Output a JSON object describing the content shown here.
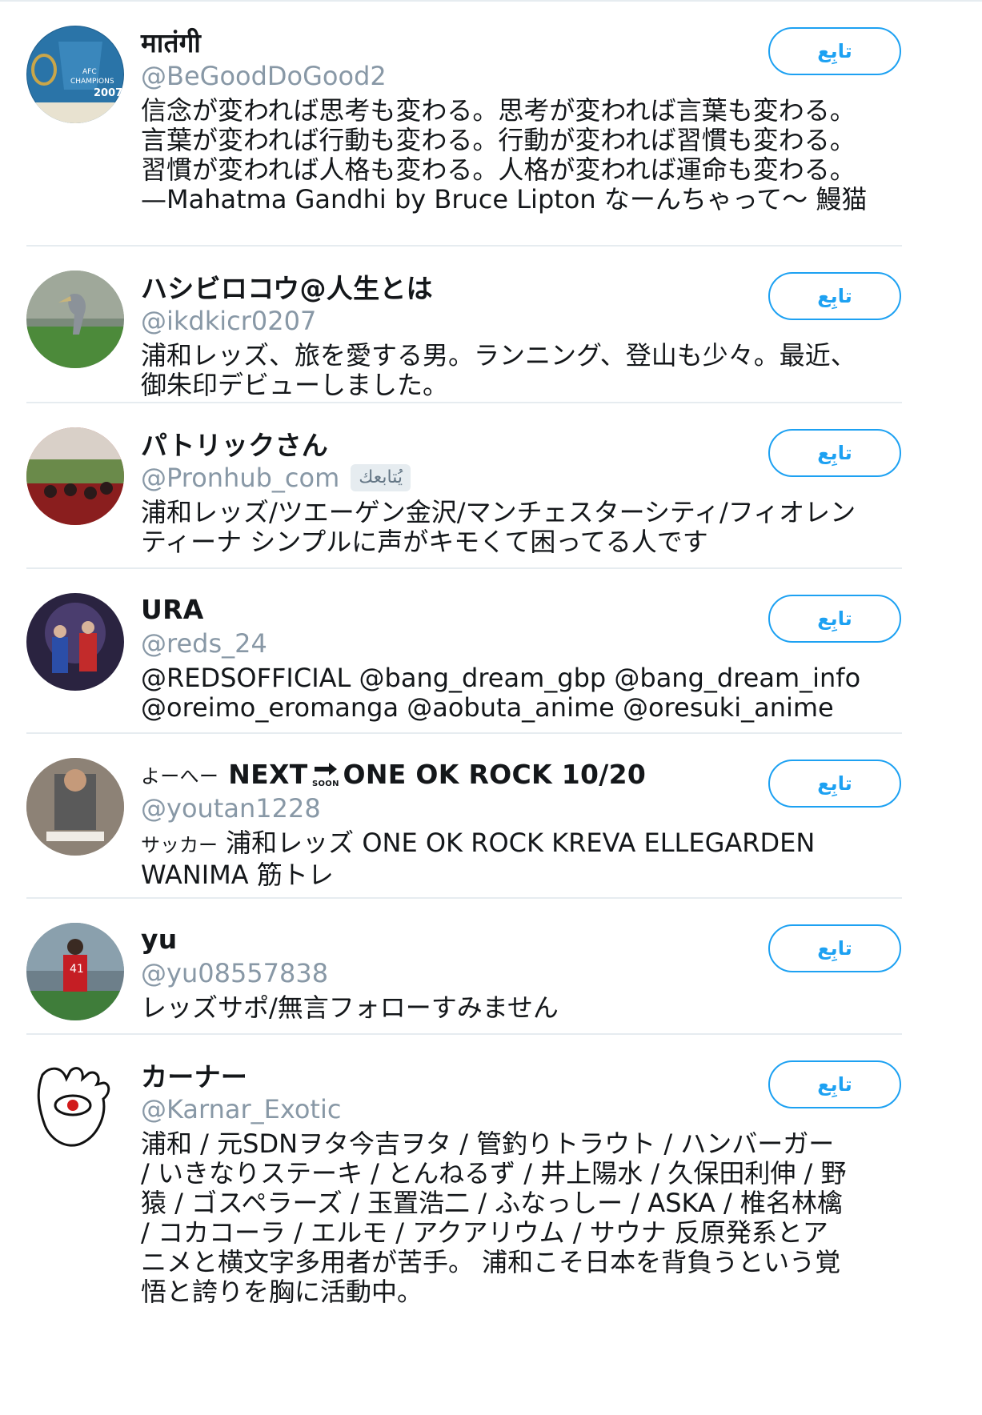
{
  "follow_label": "تابِع",
  "users": [
    {
      "name": "मातंगी",
      "handle": "@BeGoodDoGood2",
      "bio": "信念が変われば思考も変わる。思考が変われば言葉も変わる。\n言葉が変われば行動も変わる。行動が変われば習慣も変わる。\n習慣が変われば人格も変わる。人格が変われば運命も変わる。\n—Mahatma Gandhi by Bruce Lipton なーんちゃって〜 鰻猫",
      "avatar_text": "2007"
    },
    {
      "name": "ハシビロコウ@人生とは",
      "handle": "@ikdkicr0207",
      "bio": "浦和レッズ、旅を愛する男。ランニング、登山も少々。最近、\n御朱印デビューしました。"
    },
    {
      "name": "パトリックさん",
      "handle": "@Pronhub_com",
      "follows_you": "يُتابعك",
      "bio": "浦和レッズ/ツエーゲン金沢/マンチェスターシティ/フィオレン\nティーナ シンプルに声がキモくて困ってる人です"
    },
    {
      "name": "URA",
      "handle": "@reds_24",
      "bio": "@REDSOFFICIAL @bang_dream_gbp @bang_dream_info\n@oreimo_eromanga @aobuta_anime @oresuki_anime"
    },
    {
      "name_prefix": "よーへー",
      "name": "NEXT",
      "name_soon": "SOON",
      "name_suffix": "ONE OK ROCK 10/20",
      "handle": "@youtan1228",
      "bio_prefix": "サッカー",
      "bio": " 浦和レッズ ONE OK ROCK KREVA ELLEGARDEN\nWANIMA 筋トレ"
    },
    {
      "name": "yu",
      "handle": "@yu08557838",
      "bio": "レッズサポ/無言フォローすみません"
    },
    {
      "name": "カーナー",
      "handle": "@Karnar_Exotic",
      "bio": "浦和 / 元SDNヲタ今吉ヲタ / 管釣りトラウト / ハンバーガー\n / いきなりステーキ / とんねるず / 井上陽水 / 久保田利伸 / 野\n猿 / ゴスペラーズ / 玉置浩二 / ふなっしー / ASKA / 椎名林檎\n / コカコーラ / エルモ / アクアリウム / サウナ 反原発系とア\nニメと横文字多用者が苦手。 浦和こそ日本を背負うという覚\n悟と誇りを胸に活動中。"
    }
  ],
  "colors": {
    "accent": "#1da1f2",
    "muted": "#8898a6",
    "separator": "#e6ecf0"
  }
}
